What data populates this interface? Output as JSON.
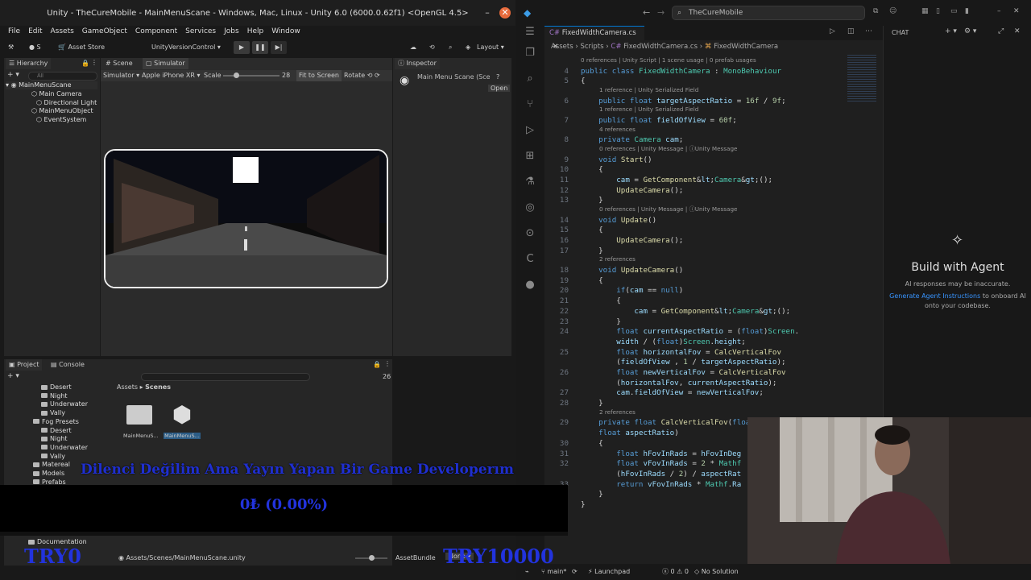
{
  "unity": {
    "title": "Unity - TheCureMobile - MainMenuScane - Windows, Mac, Linux - Unity 6.0 (6000.0.62f1) <OpenGL 4.5>",
    "menu": [
      "File",
      "Edit",
      "Assets",
      "GameObject",
      "Component",
      "Services",
      "Jobs",
      "Help",
      "Window"
    ],
    "toolbar": {
      "account": "S",
      "asset_store": "Asset Store",
      "version_control": "UnityVersionControl",
      "layout": "Layout"
    },
    "hierarchy": {
      "tab": "Hierarchy",
      "search_placeholder": "All",
      "root": "MainMenuScane",
      "items": [
        "Main Camera",
        "Directional Light",
        "MainMenuObject",
        "EventSystem"
      ]
    },
    "scene_tabs": {
      "scene": "Scene",
      "simulator": "Simulator"
    },
    "simulator_bar": {
      "mode": "Simulator",
      "device": "Apple iPhone XR",
      "scale_label": "Scale",
      "scale_value": "28",
      "fit": "Fit to Screen",
      "rotate": "Rotate"
    },
    "inspector": {
      "tab": "Inspector",
      "object": "Main Menu Scane (Sce",
      "open": "Open"
    },
    "project": {
      "tab": "Project",
      "console_tab": "Console",
      "count": "26",
      "tree": [
        {
          "label": "Desert",
          "indent": 2
        },
        {
          "label": "Night",
          "indent": 2
        },
        {
          "label": "Underwater",
          "indent": 2
        },
        {
          "label": "Vally",
          "indent": 2
        },
        {
          "label": "Fog Presets",
          "indent": 1
        },
        {
          "label": "Desert",
          "indent": 2
        },
        {
          "label": "Night",
          "indent": 2
        },
        {
          "label": "Underwater",
          "indent": 2
        },
        {
          "label": "Vally",
          "indent": 2
        },
        {
          "label": "Matereal",
          "indent": 1
        },
        {
          "label": "Models",
          "indent": 1
        },
        {
          "label": "Prefabs",
          "indent": 1
        }
      ],
      "breadcrumb": [
        "Assets",
        "Scenes"
      ],
      "assets": [
        "MainMenuS...",
        "MainMenuS..."
      ],
      "bottom_folder": "Documentation",
      "scene_path": "Assets/Scenes/MainMenuScane.unity",
      "asset_bundle": "AssetBundle",
      "asset_bundle_value": "None"
    }
  },
  "overlay": {
    "banner": "Dilenci Değilim Ama Yayın Yapan Bir Game Developerım",
    "donation": "0₺ (0.00%)",
    "try_left": "TRY0",
    "try_right": "TRY10000"
  },
  "vscode": {
    "search": "TheCureMobile",
    "tab": "FixedWidthCamera.cs",
    "breadcrumb": [
      "Assets",
      "Scripts",
      "FixedWidthCamera.cs",
      "FixedWidthCamera"
    ],
    "chat": {
      "header": "CHAT",
      "title": "Build with Agent",
      "warning": "AI responses may be inaccurate.",
      "link": "Generate Agent Instructions",
      "tail": "to onboard AI onto your codebase."
    },
    "status": {
      "branch": "main*",
      "launchpad": "Launchpad",
      "errors": "0",
      "warnings": "0",
      "solution": "No Solution"
    },
    "code": [
      {
        "lens": "0 references | Unity Script | 1 scene usage | 0 prefab usages"
      },
      {
        "n": "4",
        "t": "public class FixedWidthCamera : MonoBehaviour"
      },
      {
        "n": "5",
        "t": "{"
      },
      {
        "lens": "1 reference | Unity Serialized Field"
      },
      {
        "n": "6",
        "t": "    public float targetAspectRatio = 16f / 9f;"
      },
      {
        "lens": "1 reference | Unity Serialized Field"
      },
      {
        "n": "7",
        "t": "    public float fieldOfView = 60f;"
      },
      {
        "lens": "4 references"
      },
      {
        "n": "8",
        "t": "    private Camera cam;"
      },
      {
        "lens": "0 references | Unity Message | ⓘUnity Message"
      },
      {
        "n": "9",
        "t": "    void Start()"
      },
      {
        "n": "10",
        "t": "    {"
      },
      {
        "n": "11",
        "t": "        cam = GetComponent<Camera>();"
      },
      {
        "n": "12",
        "t": "        UpdateCamera();"
      },
      {
        "n": "13",
        "t": "    }"
      },
      {
        "lens": "0 references | Unity Message | ⓘUnity Message"
      },
      {
        "n": "14",
        "t": "    void Update()"
      },
      {
        "n": "15",
        "t": "    {"
      },
      {
        "n": "16",
        "t": "        UpdateCamera();"
      },
      {
        "n": "17",
        "t": "    }"
      },
      {
        "lens": "2 references"
      },
      {
        "n": "18",
        "t": "    void UpdateCamera()"
      },
      {
        "n": "19",
        "t": "    {"
      },
      {
        "n": "20",
        "t": "        if(cam == null)"
      },
      {
        "n": "21",
        "t": "        {"
      },
      {
        "n": "22",
        "t": "            cam = GetComponent<Camera>();"
      },
      {
        "n": "23",
        "t": "        }"
      },
      {
        "n": "24",
        "t": "        float currentAspectRatio = (float)Screen."
      },
      {
        "n": "",
        "t": "        width / (float)Screen.height;"
      },
      {
        "n": "25",
        "t": "        float horizontalFov = CalcVerticalFov"
      },
      {
        "n": "",
        "t": "        (fieldOfView , 1 / targetAspectRatio);"
      },
      {
        "n": "26",
        "t": "        float newVerticalFov = CalcVerticalFov"
      },
      {
        "n": "",
        "t": "        (horizontalFov, currentAspectRatio);"
      },
      {
        "n": "27",
        "t": "        cam.fieldOfView = newVerticalFov;"
      },
      {
        "n": "28",
        "t": "    }"
      },
      {
        "lens": "2 references"
      },
      {
        "n": "29",
        "t": "    private float CalcVerticalFov(float hFovInDeg,"
      },
      {
        "n": "",
        "t": "    float aspectRatio)"
      },
      {
        "n": "30",
        "t": "    {"
      },
      {
        "n": "31",
        "t": "        float hFovInRads = hFovInDeg"
      },
      {
        "n": "32",
        "t": "        float vFovInRads = 2 * Mathf"
      },
      {
        "n": "",
        "t": "        (hFovInRads / 2) / aspectRat"
      },
      {
        "n": "33",
        "t": "        return vFovInRads * Mathf.Ra"
      },
      {
        "n": "",
        "t": "    }"
      },
      {
        "n": "",
        "t": "}"
      }
    ]
  }
}
